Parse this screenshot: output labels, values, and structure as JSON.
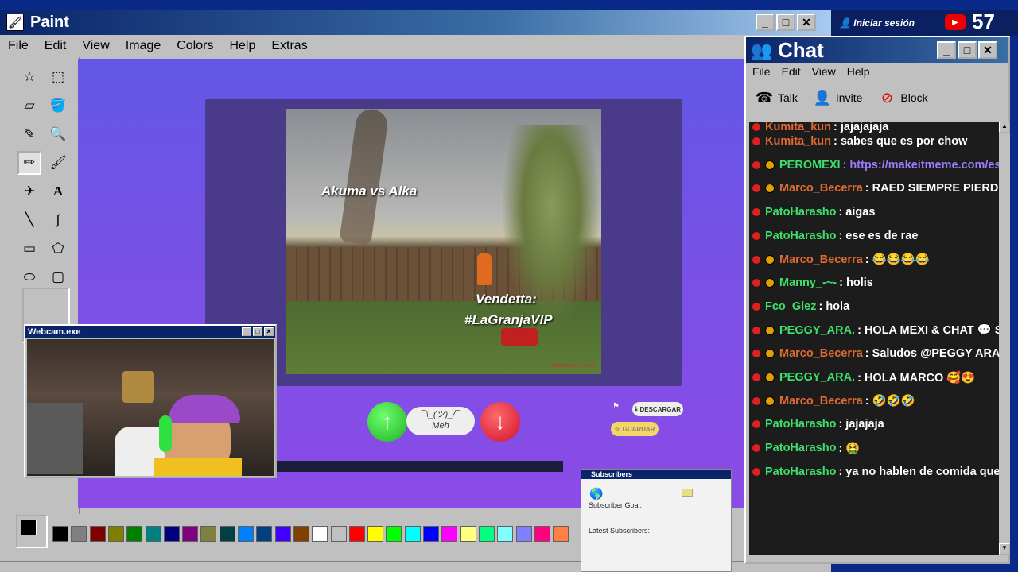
{
  "paint": {
    "title": "Paint",
    "menu": [
      "File",
      "Edit",
      "View",
      "Image",
      "Colors",
      "Help",
      "Extras"
    ],
    "palette": [
      "#000000",
      "#808080",
      "#800000",
      "#808000",
      "#008000",
      "#008080",
      "#000080",
      "#800080",
      "#808040",
      "#004040",
      "#0080ff",
      "#004080",
      "#4000ff",
      "#804000",
      "#ffffff",
      "#c0c0c0",
      "#ff0000",
      "#ffff00",
      "#00ff00",
      "#00ffff",
      "#0000ff",
      "#ff00ff",
      "#ffff80",
      "#00ff80",
      "#80ffff",
      "#8080ff",
      "#ff0080",
      "#ff8040"
    ]
  },
  "meme": {
    "top_caption": "Akuma vs Alka",
    "bottom_caption_1": "Vendetta:",
    "bottom_caption_2": "#LaGranjaVIP",
    "watermark": "makeitmeme.com",
    "meh_face": "¯\\_(ツ)_/¯",
    "meh_label": "Meh",
    "download": "DESCARGAR",
    "save": "GUARDAR"
  },
  "webcam": {
    "title": "Webcam.exe"
  },
  "subscribers": {
    "title": "Subscribers",
    "goal_label": "Subscriber Goal:",
    "latest_label": "Latest Subscribers:"
  },
  "topbar": {
    "login": "Iniciar sesión",
    "viewers": "57"
  },
  "chat": {
    "title": "Chat",
    "menu": [
      "File",
      "Edit",
      "View",
      "Help"
    ],
    "toolbar": {
      "talk": "Talk",
      "invite": "Invite",
      "block": "Block"
    },
    "messages": [
      {
        "user": "Kumita_kun",
        "color": "#e06a30",
        "badge": false,
        "text": ": jajajajaja"
      },
      {
        "user": "Kumita_kun",
        "color": "#e06a30",
        "badge": false,
        "text": ": sabes que es por chow"
      },
      {
        "user": "PEROMEXI",
        "color": "#3de06a",
        "badge": true,
        "text": ": https://makeitmeme.com/es/",
        "link": true
      },
      {
        "user": "Marco_Becerra",
        "color": "#e06a30",
        "badge": true,
        "text": ": RAED SIEMPRE PIERDE S"
      },
      {
        "user": "PatoHarasho",
        "color": "#3de06a",
        "badge": false,
        "text": ": aigas"
      },
      {
        "user": "PatoHarasho",
        "color": "#3de06a",
        "badge": false,
        "text": ": ese es de rae"
      },
      {
        "user": "Marco_Becerra",
        "color": "#e06a30",
        "badge": true,
        "text": ": 😂😂😂😂"
      },
      {
        "user": "Manny_-~-",
        "color": "#3de06a",
        "badge": true,
        "text": ": holis"
      },
      {
        "user": "Fco_Glez",
        "color": "#3de06a",
        "badge": false,
        "text": ": hola"
      },
      {
        "user": "PEGGY_ARA.",
        "color": "#3de06a",
        "badge": true,
        "text": ": HOLA MEXI & CHAT 💬 SA"
      },
      {
        "user": "Marco_Becerra",
        "color": "#e06a30",
        "badge": true,
        "text": ": Saludos @PEGGY ARA."
      },
      {
        "user": "PEGGY_ARA.",
        "color": "#3de06a",
        "badge": true,
        "text": ": HOLA MARCO 🥰😍"
      },
      {
        "user": "Marco_Becerra",
        "color": "#e06a30",
        "badge": true,
        "text": ": 🤣🤣🤣"
      },
      {
        "user": "PatoHarasho",
        "color": "#3de06a",
        "badge": false,
        "text": ": jajajaja"
      },
      {
        "user": "PatoHarasho",
        "color": "#3de06a",
        "badge": false,
        "text": ": 🤮"
      },
      {
        "user": "PatoHarasho",
        "color": "#3de06a",
        "badge": false,
        "text": ": ya no hablen de comida que m"
      }
    ]
  }
}
